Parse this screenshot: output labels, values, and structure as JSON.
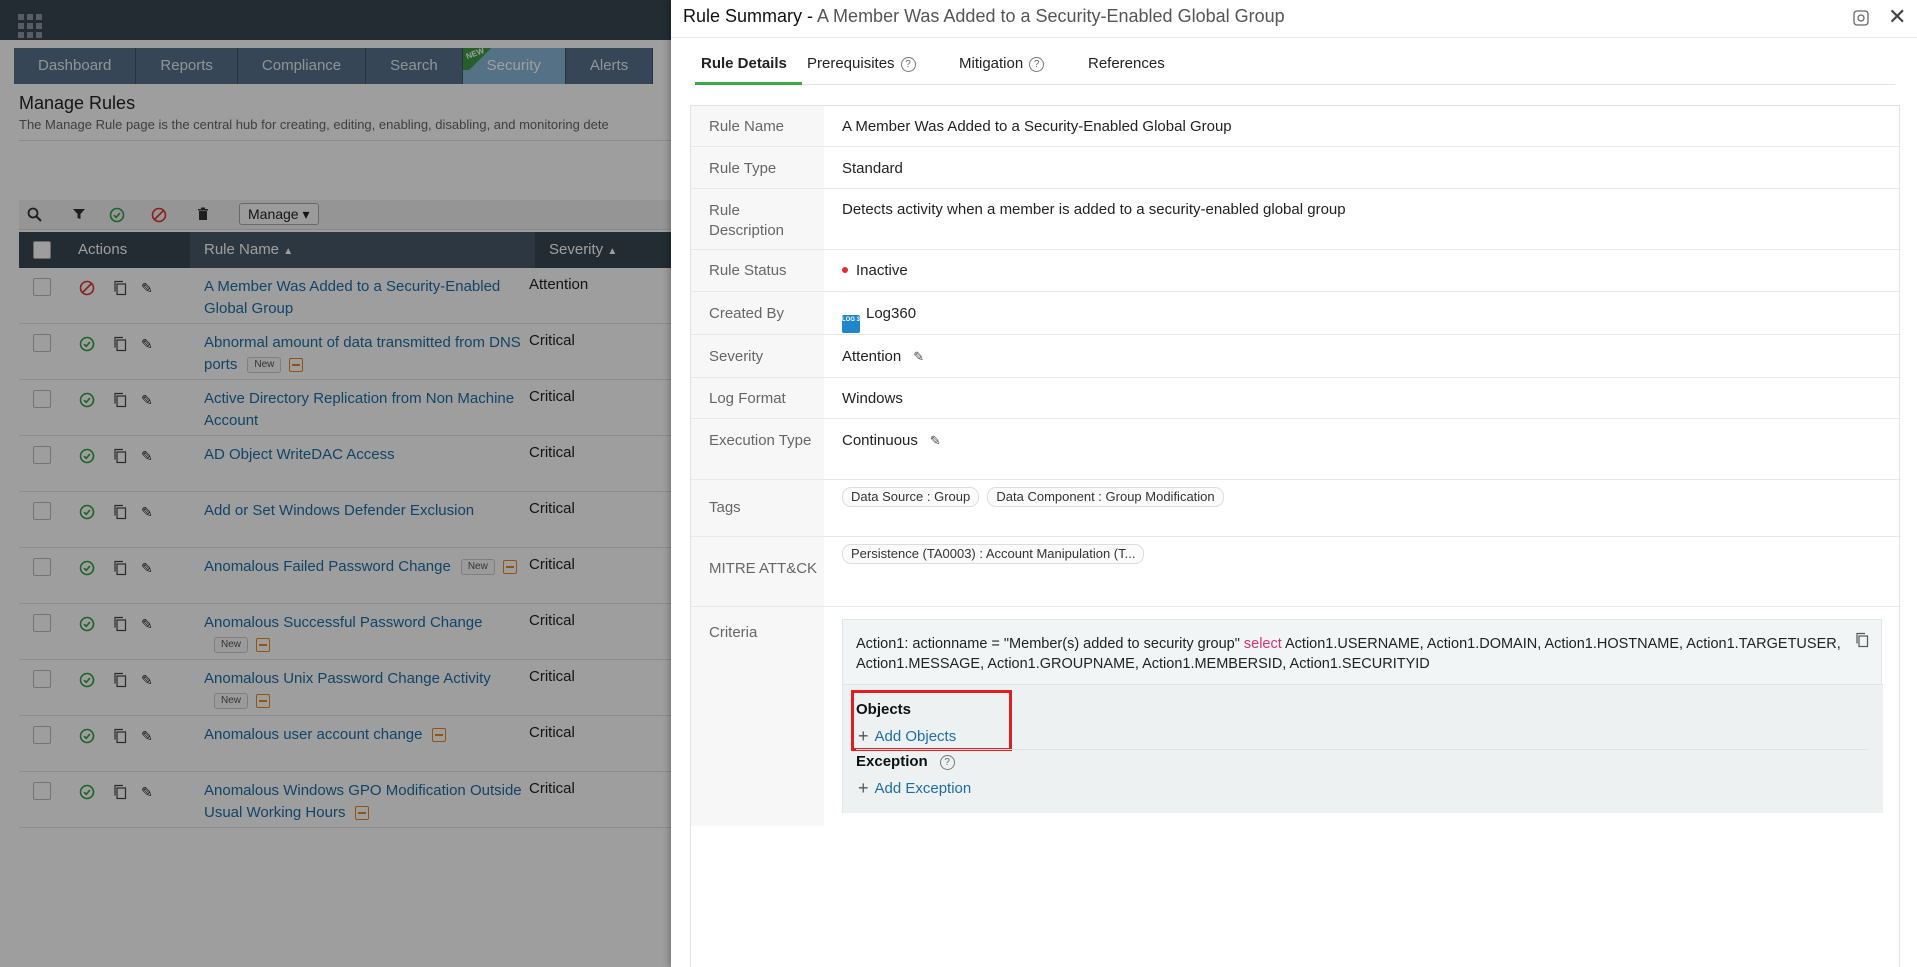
{
  "background": {
    "nav_tabs": [
      {
        "label": "Dashboard",
        "active": false
      },
      {
        "label": "Reports",
        "active": false
      },
      {
        "label": "Compliance",
        "active": false
      },
      {
        "label": "Search",
        "active": false
      },
      {
        "label": "Security",
        "active": true,
        "flag": "NEW"
      },
      {
        "label": "Alerts",
        "active": false
      }
    ],
    "page_title": "Manage Rules",
    "page_description": "The Manage Rule page is the central hub for creating, editing, enabling, disabling, and monitoring dete",
    "toolbar": {
      "manage_label": "Manage"
    },
    "table": {
      "columns": {
        "actions": "Actions",
        "rule_name": "Rule Name",
        "severity": "Severity"
      },
      "new_badge": "New",
      "rows": [
        {
          "rule": "A Member Was Added to a Security-Enabled Global Group",
          "severity": "Attention",
          "enabled": false,
          "is_new": false,
          "has_extra": false
        },
        {
          "rule": "Abnormal amount of data transmitted from DNS ports",
          "severity": "Critical",
          "enabled": true,
          "is_new": true,
          "has_extra": true
        },
        {
          "rule": "Active Directory Replication from Non Machine Account",
          "severity": "Critical",
          "enabled": true,
          "is_new": false,
          "has_extra": false
        },
        {
          "rule": "AD Object WriteDAC Access",
          "severity": "Critical",
          "enabled": true,
          "is_new": false,
          "has_extra": false
        },
        {
          "rule": "Add or Set Windows Defender Exclusion",
          "severity": "Critical",
          "enabled": true,
          "is_new": false,
          "has_extra": false
        },
        {
          "rule": "Anomalous Failed Password Change",
          "severity": "Critical",
          "enabled": true,
          "is_new": true,
          "has_extra": true
        },
        {
          "rule": "Anomalous Successful Password Change",
          "severity": "Critical",
          "enabled": true,
          "is_new": true,
          "has_extra": true
        },
        {
          "rule": "Anomalous Unix Password Change Activity",
          "severity": "Critical",
          "enabled": true,
          "is_new": true,
          "has_extra": true
        },
        {
          "rule": "Anomalous user account change",
          "severity": "Critical",
          "enabled": true,
          "is_new": false,
          "has_extra": true
        },
        {
          "rule": "Anomalous Windows GPO Modification Outside Usual Working Hours",
          "severity": "Critical",
          "enabled": true,
          "is_new": false,
          "has_extra": true
        }
      ]
    }
  },
  "panel": {
    "title_prefix": "Rule Summary - ",
    "title_rule": "A Member Was Added to a Security-Enabled Global Group",
    "tabs": [
      {
        "label": "Rule Details",
        "active": true,
        "help": false
      },
      {
        "label": "Prerequisites",
        "active": false,
        "help": true
      },
      {
        "label": "Mitigation",
        "active": false,
        "help": true
      },
      {
        "label": "References",
        "active": false,
        "help": false
      }
    ],
    "details": {
      "rule_name": {
        "label": "Rule Name",
        "value": "A Member Was Added to a Security-Enabled Global Group"
      },
      "rule_type": {
        "label": "Rule Type",
        "value": "Standard"
      },
      "rule_description": {
        "label": "Rule Description",
        "value": "Detects activity when a member is added to a security-enabled global group"
      },
      "rule_status": {
        "label": "Rule Status",
        "value": "Inactive"
      },
      "created_by": {
        "label": "Created By",
        "value": "Log360",
        "logo": "LOG 360"
      },
      "severity": {
        "label": "Severity",
        "value": "Attention"
      },
      "log_format": {
        "label": "Log Format",
        "value": "Windows"
      },
      "execution_type": {
        "label": "Execution Type",
        "value": "Continuous"
      },
      "tags": {
        "label": "Tags",
        "values": [
          "Data Source : Group",
          "Data Component : Group Modification"
        ]
      },
      "mitre": {
        "label": "MITRE ATT&CK",
        "values": [
          "Persistence (TA0003) : Account Manipulation (T..."
        ]
      },
      "criteria": {
        "label": "Criteria",
        "text_before": "Action1: actionname = \"Member(s) added to security group\" ",
        "keyword": "select",
        "text_after": " Action1.USERNAME, Action1.DOMAIN, Action1.HOSTNAME, Action1.TARGETUSER, Action1.MESSAGE, Action1.GROUPNAME, Action1.MEMBERSID, Action1.SECURITYID",
        "objects_title": "Objects",
        "add_objects": "Add Objects",
        "exception_title": "Exception",
        "add_exception": "Add Exception"
      }
    }
  },
  "colors": {
    "accent_green": "#3fa74a",
    "link_blue": "#1d6ea7",
    "highlight_red": "#e02020",
    "nav_dark": "#394653"
  }
}
